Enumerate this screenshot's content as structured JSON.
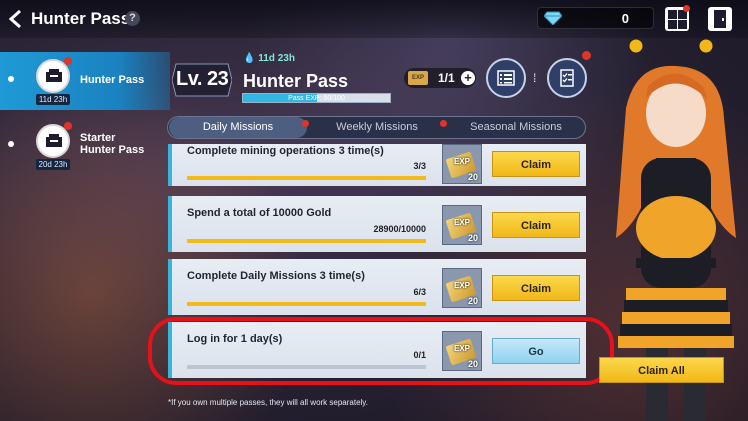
{
  "header": {
    "title": "Hunter Pass",
    "help_icon": "?",
    "gem_count": "0"
  },
  "sidebar": {
    "items": [
      {
        "label": "Hunter Pass",
        "timer": "11d 23h",
        "icon": "ticket-icon",
        "active": true
      },
      {
        "label": "Starter Hunter Pass",
        "label_line1": "Starter",
        "label_line2": "Hunter Pass",
        "timer": "20d 23h",
        "icon": "ticket-icon",
        "active": false
      }
    ]
  },
  "pass": {
    "level": "Lv. 23",
    "timer": "11d 23h",
    "title": "Hunter Pass",
    "exp_label": "Pass EXP: 50/100",
    "exp_fraction": 0.5,
    "ticket_count": "1/1",
    "ticket_label": "EXP"
  },
  "tabs": [
    {
      "label": "Daily Missions",
      "active": true
    },
    {
      "label": "Weekly Missions",
      "active": false
    },
    {
      "label": "Seasonal Missions",
      "active": false
    }
  ],
  "missions": [
    {
      "title": "Complete mining operations 3 time(s)",
      "progress": "3/3",
      "fraction": 1.0,
      "reward_label": "EXP",
      "reward_qty": "20",
      "action": "Claim",
      "action_type": "claim"
    },
    {
      "title": "Spend a total of 10000 Gold",
      "progress": "28900/10000",
      "fraction": 1.0,
      "reward_label": "EXP",
      "reward_qty": "20",
      "action": "Claim",
      "action_type": "claim"
    },
    {
      "title": "Complete Daily Missions 3 time(s)",
      "progress": "6/3",
      "fraction": 1.0,
      "reward_label": "EXP",
      "reward_qty": "20",
      "action": "Claim",
      "action_type": "claim"
    },
    {
      "title": "Log in for 1 day(s)",
      "progress": "0/1",
      "fraction": 0.0,
      "reward_label": "EXP",
      "reward_qty": "20",
      "action": "Go",
      "action_type": "go"
    }
  ],
  "claim_all": "Claim All",
  "footnote": "*If you own multiple passes, they will all work separately.",
  "colors": {
    "accent_blue": "#1f9ad6",
    "claim_yellow": "#f0b818",
    "badge_red": "#e0342a",
    "highlight_ring": "#e8101a"
  }
}
